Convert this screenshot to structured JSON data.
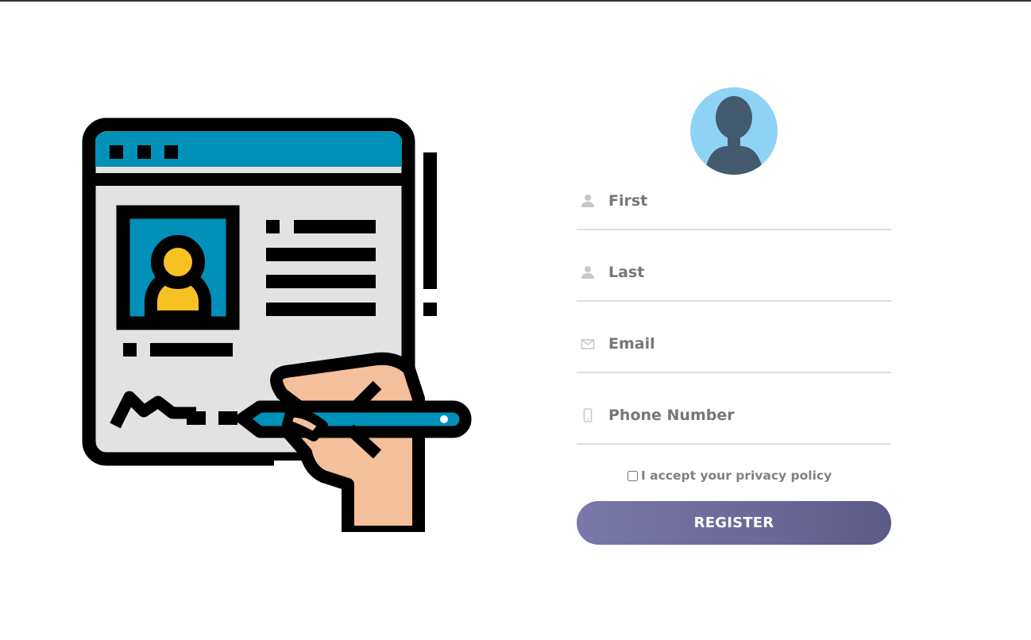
{
  "form": {
    "fields": {
      "first": {
        "placeholder": "First",
        "icon": "user-icon"
      },
      "last": {
        "placeholder": "Last",
        "icon": "user-icon"
      },
      "email": {
        "placeholder": "Email",
        "icon": "envelope-icon"
      },
      "phone": {
        "placeholder": "Phone Number",
        "icon": "phone-icon"
      }
    },
    "privacy_label": "I accept your privacy policy",
    "privacy_checked": false,
    "register_label": "REGISTER"
  },
  "colors": {
    "accent_gradient_start": "#7a78aa",
    "accent_gradient_end": "#5c5a86",
    "avatar_bg": "#8fd3f4",
    "avatar_silhouette": "#435a6f",
    "illustration_blue": "#0090b8",
    "illustration_yellow": "#f6c223",
    "illustration_skin": "#f4bf9b"
  }
}
